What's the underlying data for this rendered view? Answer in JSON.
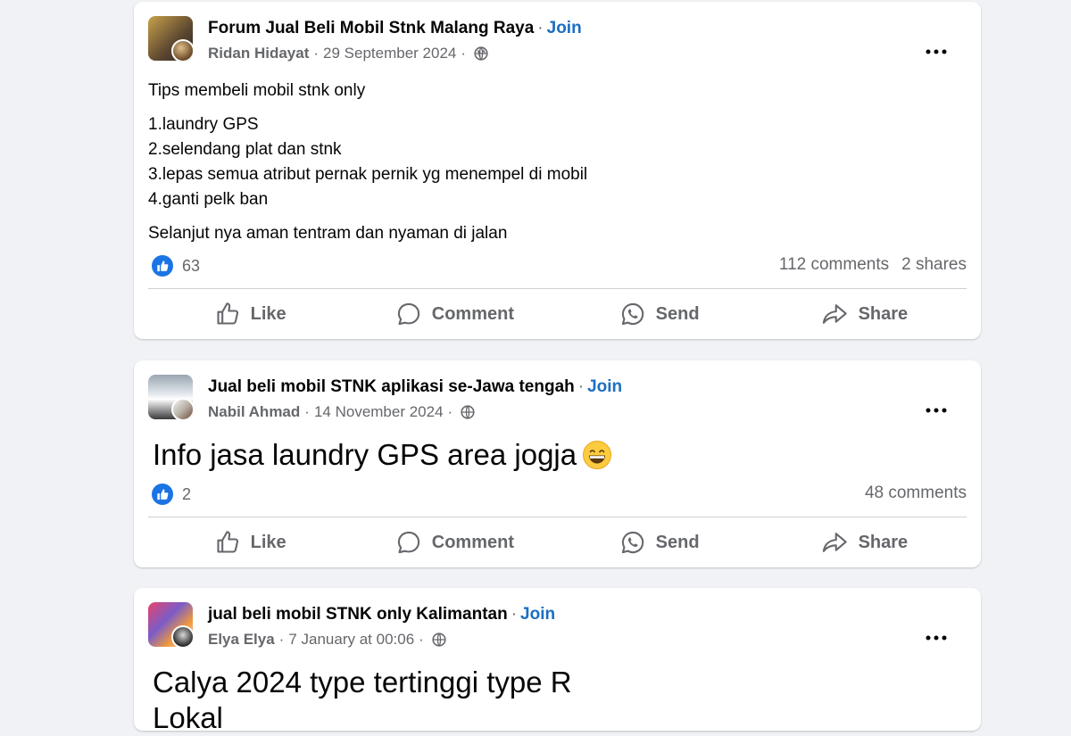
{
  "posts": [
    {
      "group": "Forum Jual Beli Mobil Stnk Malang Raya",
      "join": "Join",
      "author": "Ridan Hidayat",
      "date": "29 September 2024",
      "body": {
        "title": "Tips membeli mobil stnk only",
        "list": [
          "1.laundry GPS",
          "2.selendang plat dan stnk",
          "3.lepas semua atribut pernak pernik yg menempel di mobil",
          "4.ganti pelk ban"
        ],
        "closing": "Selanjut nya aman tentram dan nyaman di jalan"
      },
      "likes": "63",
      "comments": "112 comments",
      "shares": "2 shares"
    },
    {
      "group": "Jual beli mobil STNK aplikasi se-Jawa tengah",
      "join": "Join",
      "author": "Nabil Ahmad",
      "date": "14 November 2024",
      "body_text": "Info jasa laundry GPS area jogja",
      "likes": "2",
      "comments": "48 comments"
    },
    {
      "group": "jual beli mobil STNK only Kalimantan",
      "join": "Join",
      "author": "Elya Elya",
      "date": "7 January at 00:06",
      "body_lines": [
        "Calya 2024 type tertinggi type R",
        "Lokal"
      ]
    }
  ],
  "actions": {
    "like": "Like",
    "comment": "Comment",
    "send": "Send",
    "share": "Share"
  },
  "separators": {
    "dot": "·"
  },
  "icons": {
    "privacy": "globe-icon",
    "menu": "more-options-icon",
    "reaction": "thumbs-up-icon",
    "emoji": "grinning-face-emoji"
  },
  "colors": {
    "link": "#1b6fc2",
    "like_badge": "#1b74e4",
    "muted": "#65676b",
    "background": "#f0f2f5"
  }
}
